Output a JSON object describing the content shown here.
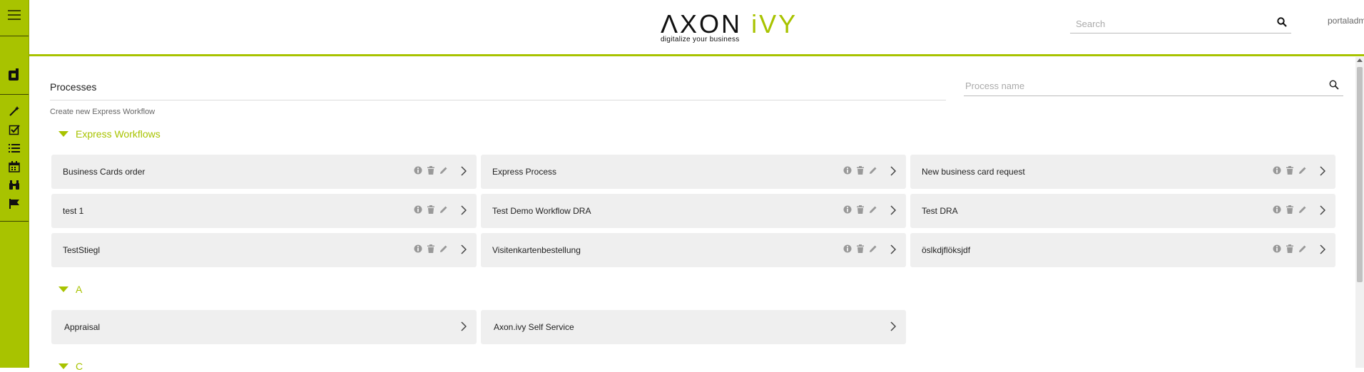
{
  "header": {
    "logo_main": "ΛXON",
    "logo_accent": "iVY",
    "logo_tagline": "digitalize your business",
    "search_placeholder": "Search",
    "user_name": "portaladmin"
  },
  "sidebar": {
    "icons": [
      "menu-icon",
      "app-logo-icon",
      "magic-wand-icon",
      "checkbox-icon",
      "list-icon",
      "calendar-icon",
      "binoculars-icon",
      "flag-icon"
    ]
  },
  "main": {
    "title": "Processes",
    "search_placeholder": "Process name",
    "create_link": "Create new Express Workflow",
    "groups": [
      {
        "label": "Express Workflows",
        "items": [
          {
            "name": "Business Cards order",
            "actions": true
          },
          {
            "name": "Express Process",
            "actions": true
          },
          {
            "name": "New business card request",
            "actions": true
          },
          {
            "name": "test 1",
            "actions": true
          },
          {
            "name": "Test Demo Workflow DRA",
            "actions": true
          },
          {
            "name": "Test DRA",
            "actions": true
          },
          {
            "name": "TestStiegl",
            "actions": true
          },
          {
            "name": "Visitenkartenbestellung",
            "actions": true
          },
          {
            "name": "öslkdjflöksjdf",
            "actions": true
          }
        ]
      },
      {
        "label": "A",
        "items": [
          {
            "name": "Appraisal",
            "actions": false
          },
          {
            "name": "Axon.ivy Self Service",
            "actions": false
          }
        ]
      },
      {
        "label": "C",
        "items": []
      }
    ]
  },
  "colors": {
    "accent": "#a8c300",
    "card_bg": "#efefef"
  }
}
